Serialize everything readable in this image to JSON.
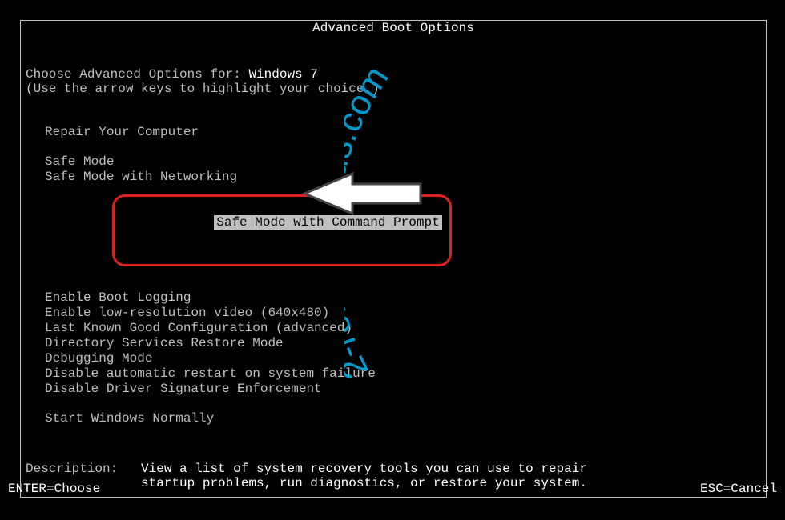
{
  "title": "Advanced Boot Options",
  "prompt_prefix": "Choose Advanced Options for: ",
  "os_name": "Windows 7",
  "hint": "(Use the arrow keys to highlight your choice.)",
  "menu": {
    "repair": "Repair Your Computer",
    "safe_mode": "Safe Mode",
    "safe_mode_net": "Safe Mode with Networking",
    "safe_mode_cmd": "Safe Mode with Command Prompt",
    "boot_log": "Enable Boot Logging",
    "low_res": "Enable low-resolution video (640x480)",
    "last_good": "Last Known Good Configuration (advanced)",
    "ds_restore": "Directory Services Restore Mode",
    "debug": "Debugging Mode",
    "no_auto_restart": "Disable automatic restart on system failure",
    "no_driver_sig": "Disable Driver Signature Enforcement",
    "start_normal": "Start Windows Normally"
  },
  "description_label": "Description:   ",
  "description_line1": "View a list of system recovery tools you can use to repair",
  "description_line2": "startup problems, run diagnostics, or restore your system.",
  "footer_left": "ENTER=Choose",
  "footer_right": "ESC=Cancel",
  "watermark": "2-remove-virus.com"
}
